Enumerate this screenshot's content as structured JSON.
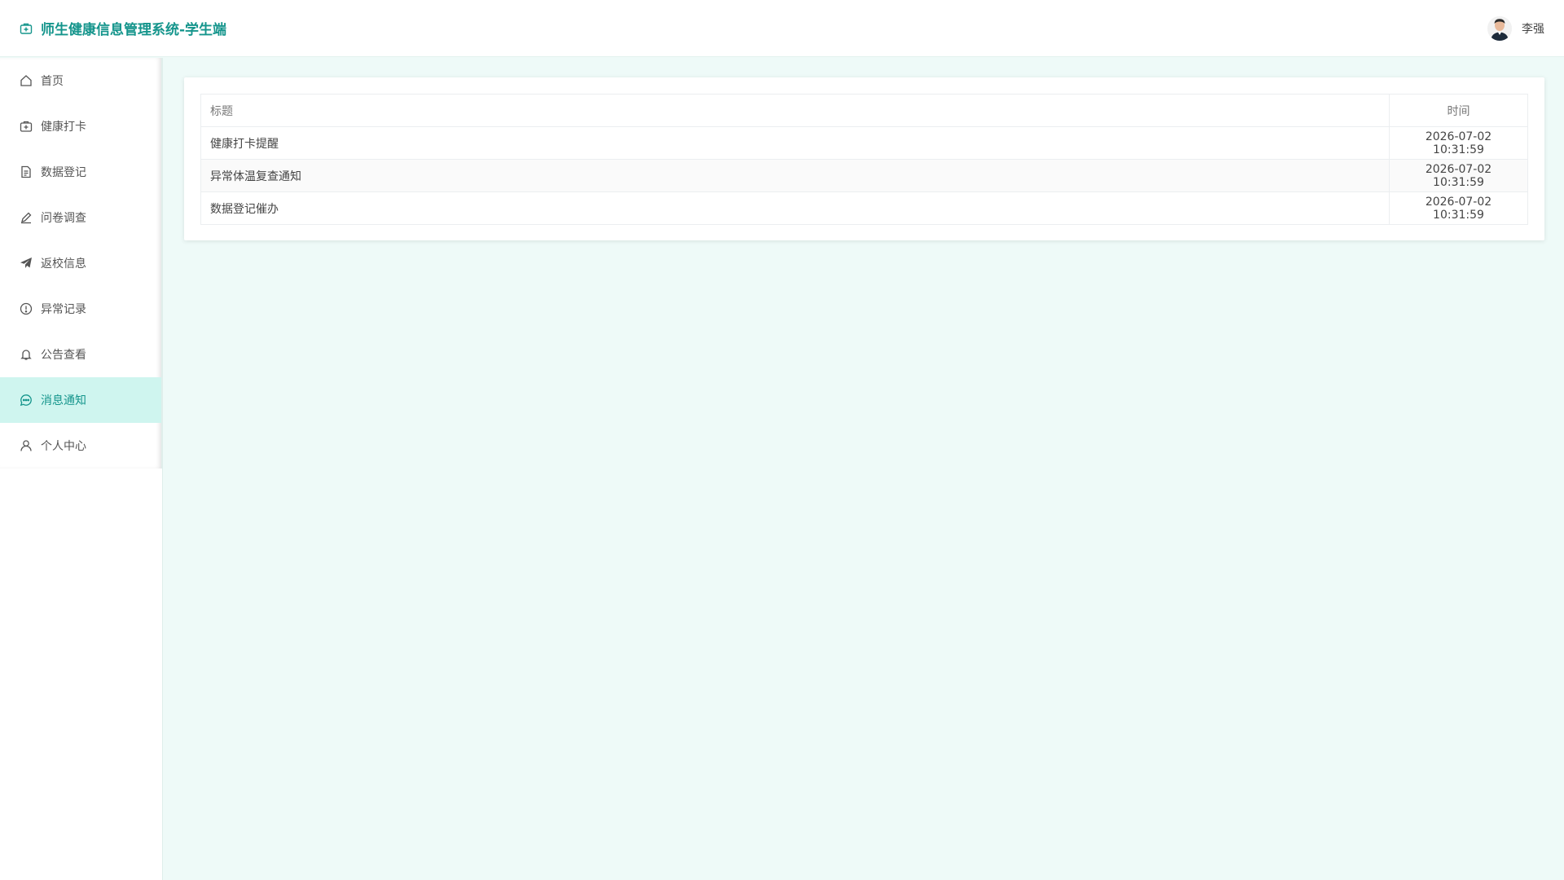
{
  "app": {
    "title": "师生健康信息管理系统-学生端",
    "brand_icon": "medical-kit-icon"
  },
  "user": {
    "name": "李强",
    "avatar_icon": "user-avatar"
  },
  "colors": {
    "accent": "#15958c",
    "active_bg": "#cff5ef",
    "page_bg": "#eefaf8"
  },
  "sidebar": {
    "items": [
      {
        "label": "首页",
        "icon": "home-icon",
        "active": false
      },
      {
        "label": "健康打卡",
        "icon": "medical-kit-icon",
        "active": false
      },
      {
        "label": "数据登记",
        "icon": "document-icon",
        "active": false
      },
      {
        "label": "问卷调查",
        "icon": "pen-icon",
        "active": false
      },
      {
        "label": "返校信息",
        "icon": "paper-plane-icon",
        "active": false
      },
      {
        "label": "异常记录",
        "icon": "alert-circle-icon",
        "active": false
      },
      {
        "label": "公告查看",
        "icon": "bell-icon",
        "active": false
      },
      {
        "label": "消息通知",
        "icon": "chat-icon",
        "active": true
      },
      {
        "label": "个人中心",
        "icon": "user-icon",
        "active": false
      }
    ]
  },
  "table": {
    "columns": {
      "title": "标题",
      "time": "时间"
    },
    "rows": [
      {
        "title": "健康打卡提醒",
        "time": "2026-07-02 10:31:59"
      },
      {
        "title": "异常体温复查通知",
        "time": "2026-07-02 10:31:59"
      },
      {
        "title": "数据登记催办",
        "time": "2026-07-02 10:31:59"
      }
    ]
  }
}
